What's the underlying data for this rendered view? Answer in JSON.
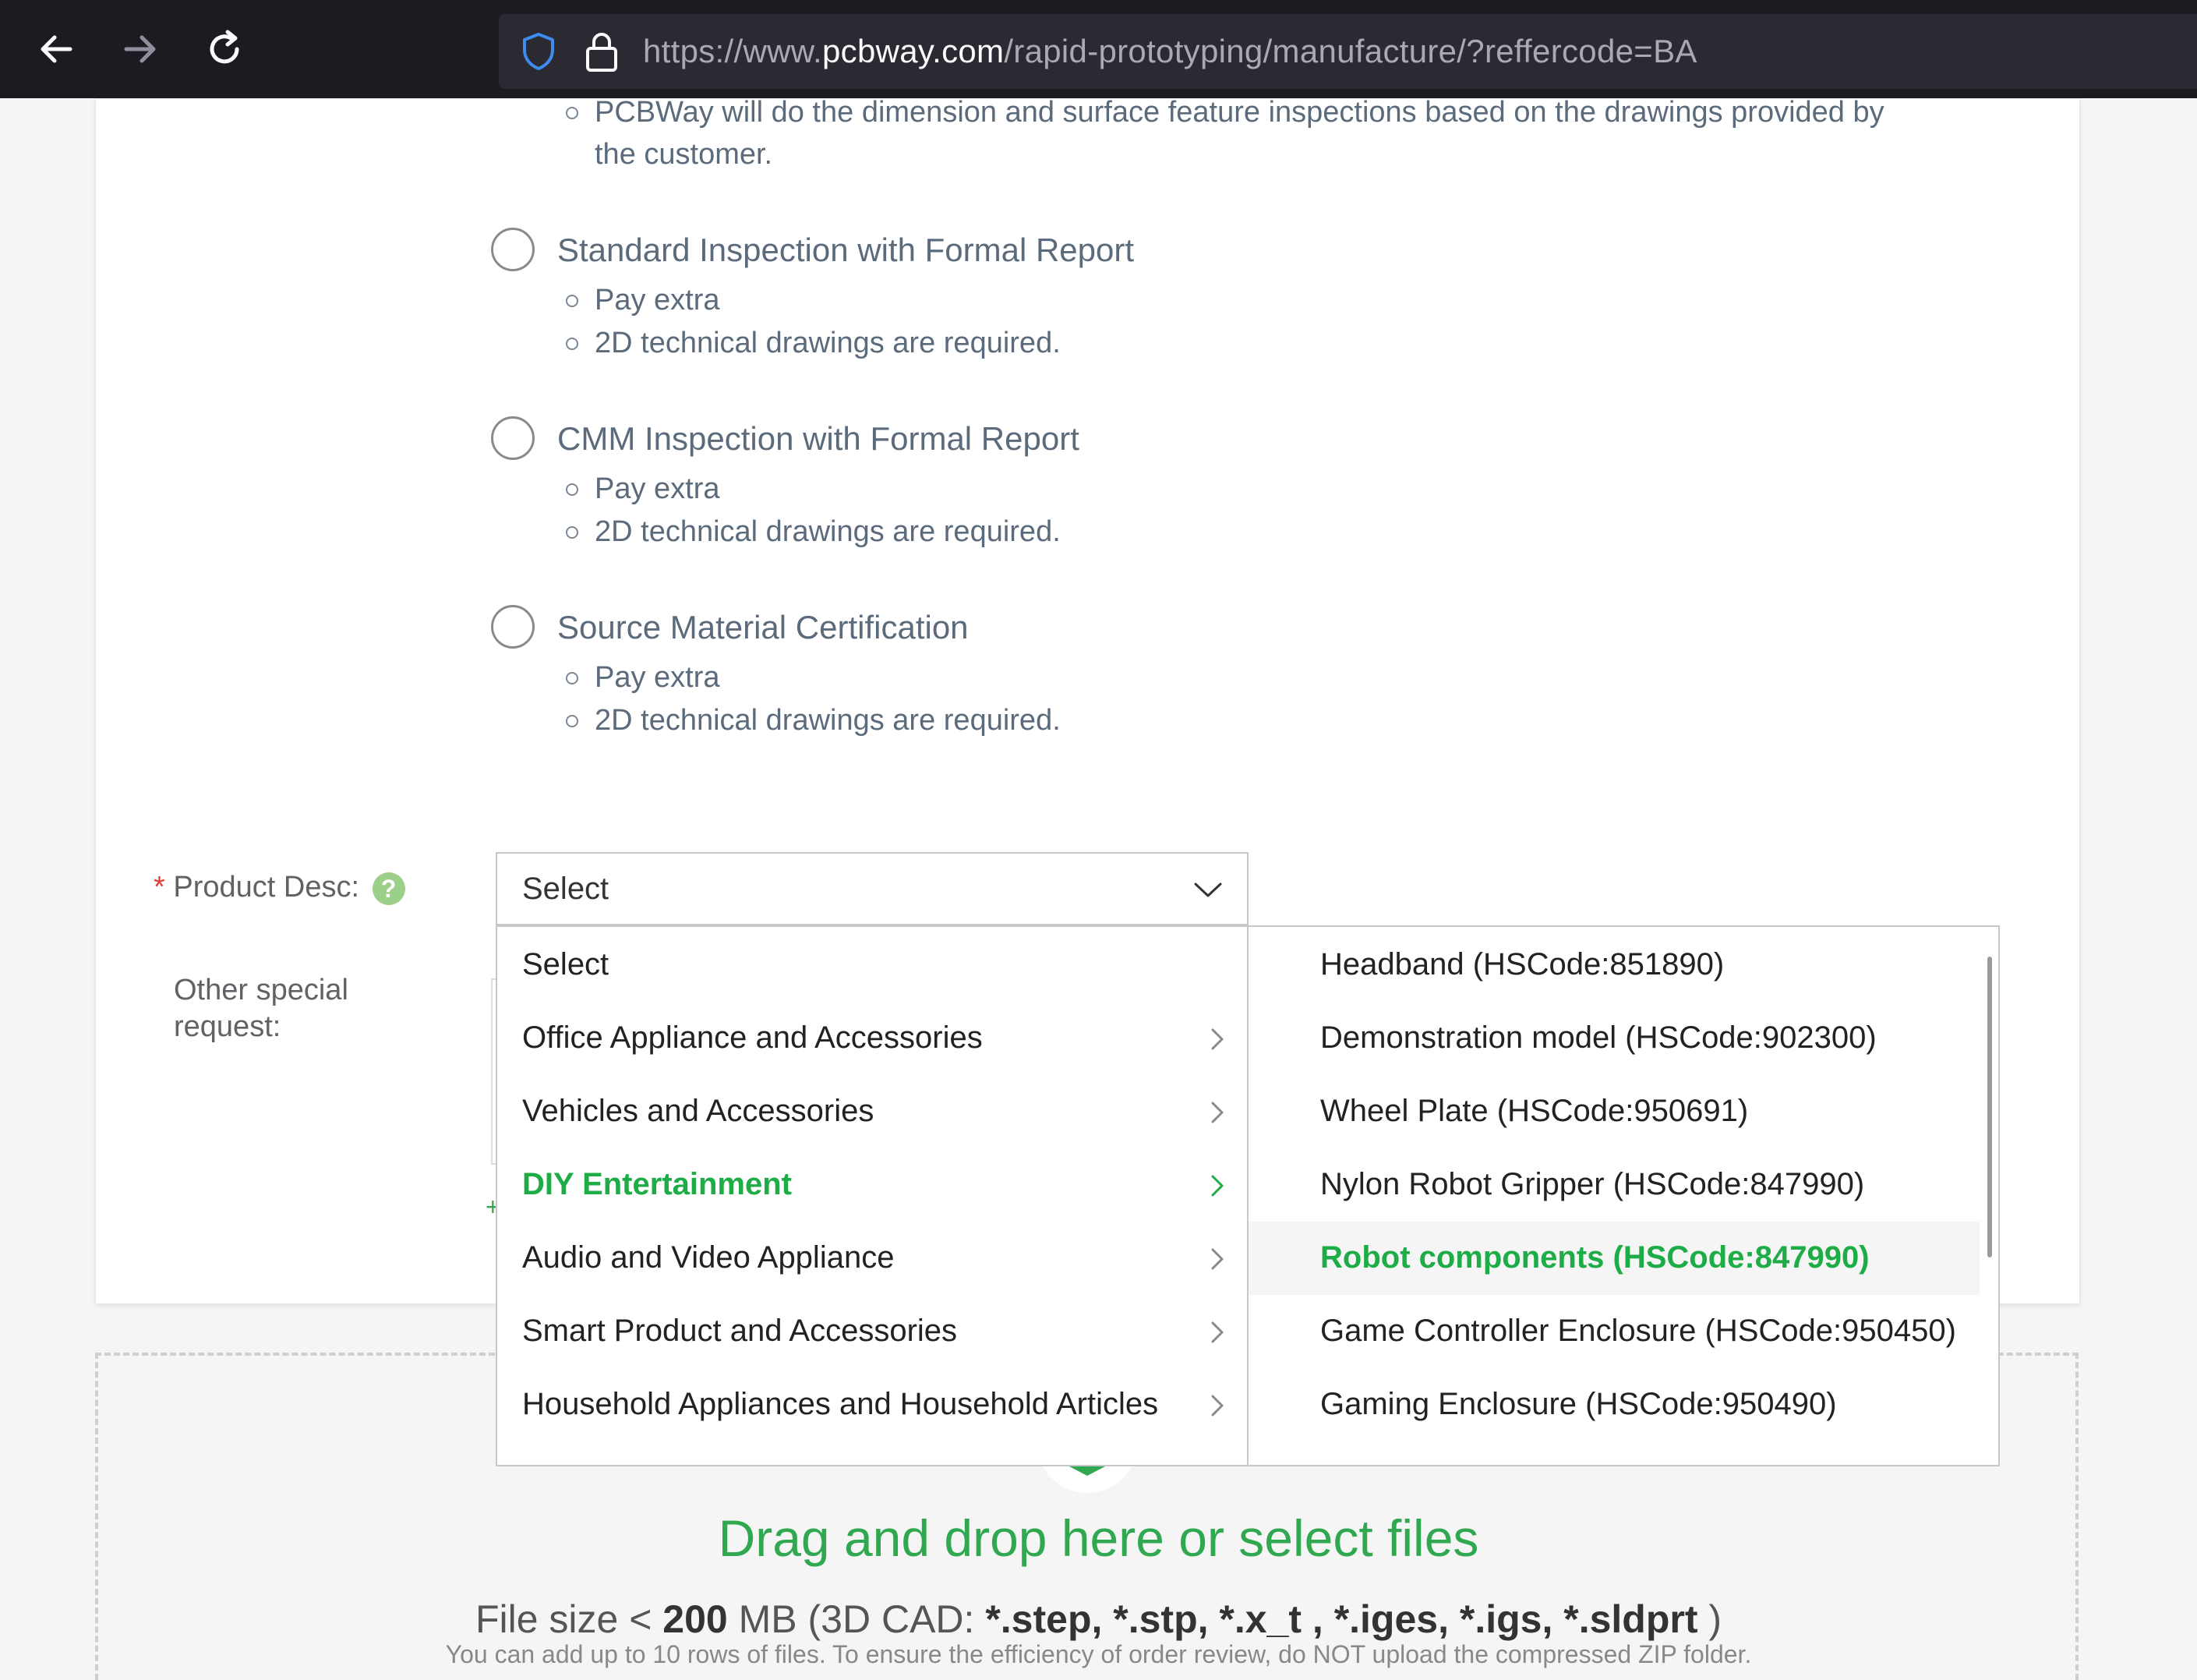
{
  "browser": {
    "url_prefix": "https://www.",
    "url_host": "pcbway.com",
    "url_path": "/rapid-prototyping/manufacture/?reffercode=BA"
  },
  "inspection": {
    "top_bullet_line1": "PCBWay will do the dimension and surface feature inspections based on the drawings provided by",
    "top_bullet_line2": "the customer.",
    "options": [
      {
        "label": "Standard Inspection with Formal Report",
        "bullets": [
          "Pay extra",
          "2D technical drawings are required."
        ]
      },
      {
        "label": "CMM Inspection with Formal Report",
        "bullets": [
          "Pay extra",
          "2D technical drawings are required."
        ]
      },
      {
        "label": "Source Material Certification",
        "bullets": [
          "Pay extra",
          "2D technical drawings are required."
        ]
      }
    ]
  },
  "form": {
    "required_mark": "*",
    "product_desc_label": "Product Desc:",
    "help_glyph": "?",
    "other_request_label_line1": "Other special",
    "other_request_label_line2": "request:",
    "select_value": "Select",
    "partial_plus": "+"
  },
  "dropdown": {
    "categories": [
      {
        "label": "Select",
        "has_children": false,
        "active": false
      },
      {
        "label": "Office Appliance and Accessories",
        "has_children": true,
        "active": false
      },
      {
        "label": "Vehicles and Accessories",
        "has_children": true,
        "active": false
      },
      {
        "label": "DIY Entertainment",
        "has_children": true,
        "active": true
      },
      {
        "label": "Audio and Video Appliance",
        "has_children": true,
        "active": false
      },
      {
        "label": "Smart Product and Accessories",
        "has_children": true,
        "active": false
      },
      {
        "label": "Household Appliances and Household Articles",
        "has_children": true,
        "active": false
      }
    ],
    "subitems": [
      {
        "label": "Headband (HSCode:851890)",
        "active": false
      },
      {
        "label": "Demonstration model (HSCode:902300)",
        "active": false
      },
      {
        "label": "Wheel Plate (HSCode:950691)",
        "active": false
      },
      {
        "label": "Nylon Robot Gripper (HSCode:847990)",
        "active": false
      },
      {
        "label": "Robot components (HSCode:847990)",
        "active": true
      },
      {
        "label": "Game Controller Enclosure (HSCode:950450)",
        "active": false
      },
      {
        "label": "Gaming Enclosure (HSCode:950490)",
        "active": false
      }
    ]
  },
  "upload": {
    "drag_text": "Drag and drop here or select files",
    "size_prefix": "File size < ",
    "size_value": "200",
    "size_mid": " MB (3D CAD: ",
    "extensions": "*.step, *.stp, *.x_t , *.iges, *.igs, *.sldprt",
    "size_suffix": "   )",
    "note": "You can add up to 10 rows of files. To ensure the efficiency of order review, do NOT upload the compressed ZIP folder."
  },
  "colors": {
    "accent_green": "#1eac46",
    "chrome_bg": "#1c1b22",
    "required_red": "#e23b3b"
  }
}
